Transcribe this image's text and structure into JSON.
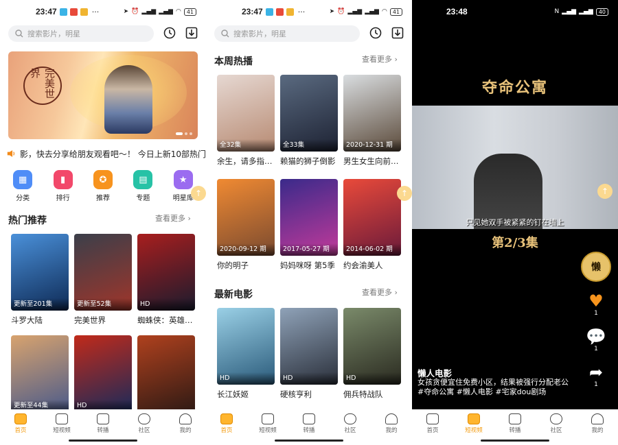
{
  "panel1": {
    "status": {
      "time": "23:47",
      "dots": "···",
      "battery": "41"
    },
    "search": {
      "placeholder": "搜索影片，明星"
    },
    "marquee": {
      "text": "影，快去分享给朋友观看吧～！ 今日上新10部热门"
    },
    "categories": [
      {
        "label": "分类",
        "color": "#4f8df7"
      },
      {
        "label": "排行",
        "color": "#f2486a"
      },
      {
        "label": "推荐",
        "color": "#f7931e"
      },
      {
        "label": "专题",
        "color": "#27c2a6"
      },
      {
        "label": "明星库",
        "color": "#9b6cf0"
      }
    ],
    "section": {
      "title": "热门推荐",
      "more": "查看更多"
    },
    "cards": [
      {
        "title": "斗罗大陆",
        "badge": "更新至201集",
        "c1": "#4a90d9",
        "c2": "#0e2a55"
      },
      {
        "title": "完美世界",
        "badge": "更新至52集",
        "c1": "#3b3f4a",
        "c2": "#a0352a"
      },
      {
        "title": "蜘蛛侠：英雄…",
        "badge": "HD",
        "c1": "#a81e1e",
        "c2": "#1b1b2e"
      },
      {
        "title": "",
        "badge": "更新至44集",
        "c1": "#d8a36e",
        "c2": "#4a5a8a"
      },
      {
        "title": "",
        "badge": "HD",
        "c1": "#c12a1a",
        "c2": "#1a2a5a"
      },
      {
        "title": "",
        "badge": "",
        "c1": "#b0411e",
        "c2": "#2e1a14"
      }
    ]
  },
  "panel2": {
    "status": {
      "time": "23:47",
      "dots": "···",
      "battery": "41"
    },
    "search": {
      "placeholder": "搜索影片，明星"
    },
    "sec1": {
      "title": "本周热播",
      "more": "查看更多"
    },
    "cards1": [
      {
        "title": "余生，请多指…",
        "badge": "全32集",
        "c1": "#e6d8d2",
        "c2": "#b78a72"
      },
      {
        "title": "赖猫的狮子倒影",
        "badge": "全33集",
        "c1": "#5a6a80",
        "c2": "#1d2233"
      },
      {
        "title": "男生女生向前…",
        "badge": "2020-12-31 期",
        "c1": "#d9dde0",
        "c2": "#5b4a3a"
      },
      {
        "title": "你的明子",
        "badge": "2020-09-12 期",
        "c1": "#f08a32",
        "c2": "#7a4a30"
      },
      {
        "title": "妈妈咪呀 第5季",
        "badge": "2017-05-27 期",
        "c1": "#3a2a8a",
        "c2": "#c23a9a"
      },
      {
        "title": "约会渝美人",
        "badge": "2014-06-02 期",
        "c1": "#e94a3a",
        "c2": "#6a1a3a"
      }
    ],
    "sec2": {
      "title": "最新电影",
      "more": "查看更多"
    },
    "cards2": [
      {
        "title": "长江妖姬",
        "badge": "HD",
        "c1": "#9ad0e6",
        "c2": "#2a5a7a"
      },
      {
        "title": "硬核亨利",
        "badge": "HD",
        "c1": "#8fa2b8",
        "c2": "#2a2f3a"
      },
      {
        "title": "佣兵特战队",
        "badge": "HD",
        "c1": "#7a8a6a",
        "c2": "#2a2a20"
      }
    ]
  },
  "panel3": {
    "status": {
      "time": "23:48",
      "battery": "40"
    },
    "drama_title": "夺命公寓",
    "subtitle": "只见她双手被紧紧的钉在墙上",
    "episode": "第2/3集",
    "avatar": "懒",
    "likes": "1",
    "comments": "1",
    "shares": "1",
    "author": "懒人电影",
    "desc": "女孩贪便宜住免费小区，结果被强行分配老公#夺命公寓 #懒人电影 #宅家dou剧场"
  },
  "tabs": [
    "首页",
    "短视频",
    "转播",
    "社区",
    "我的"
  ]
}
